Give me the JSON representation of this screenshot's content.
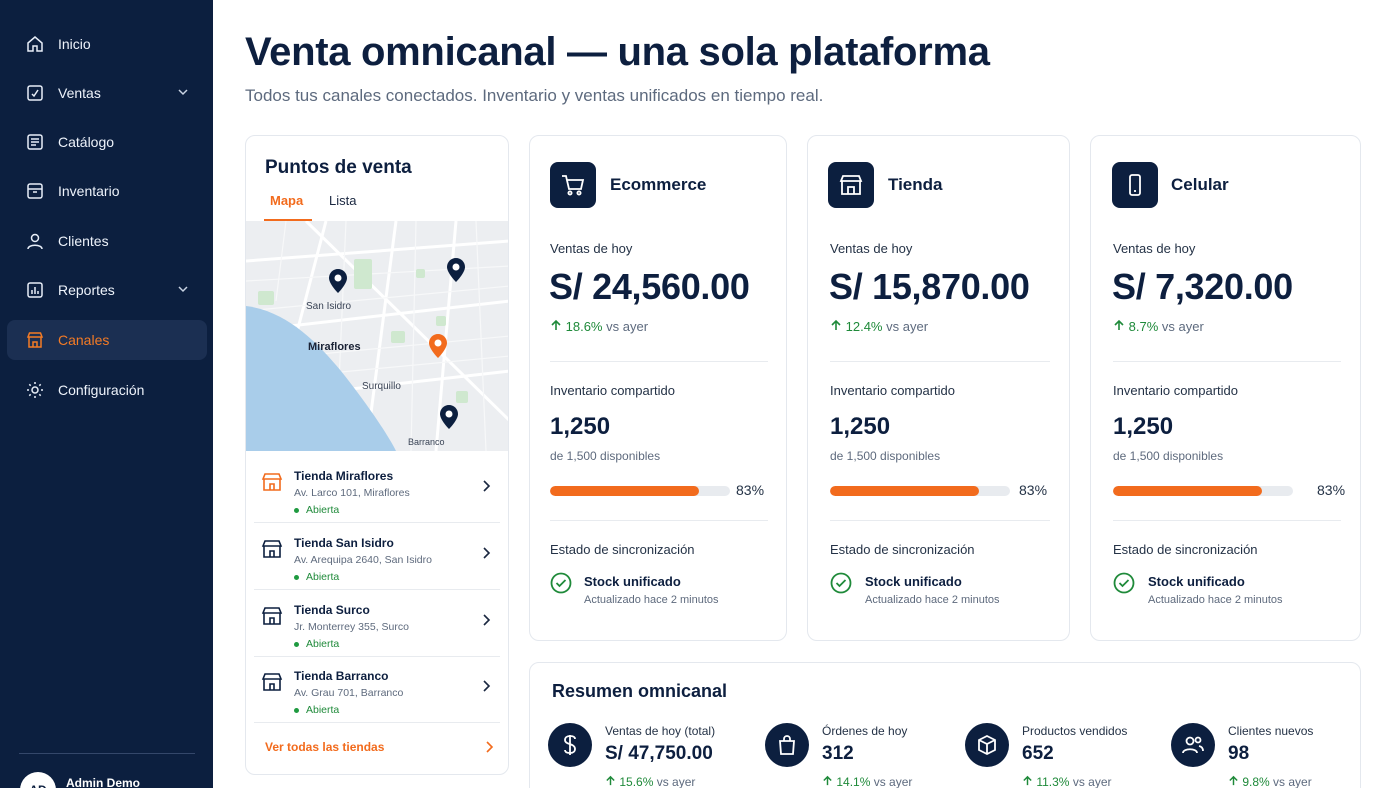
{
  "sidebar": {
    "items": [
      {
        "label": "Inicio",
        "icon": "home-icon"
      },
      {
        "label": "Ventas",
        "icon": "receipt-icon"
      },
      {
        "label": "Catálogo",
        "icon": "catalog-icon"
      },
      {
        "label": "Inventario",
        "icon": "inventory-icon"
      },
      {
        "label": "Clientes",
        "icon": "user-icon"
      },
      {
        "label": "Reportes",
        "icon": "chart-icon"
      },
      {
        "label": "Canales",
        "icon": "store-icon"
      },
      {
        "label": "Configuración",
        "icon": "gear-icon"
      }
    ],
    "active": "Canales",
    "user": {
      "initials": "AD",
      "name": "Admin Demo"
    }
  },
  "header": {
    "title": "Venta omnicanal — una sola plataforma",
    "subtitle": "Todos tus canales conectados. Inventario y ventas unificados en tiempo real."
  },
  "points_of_sale": {
    "title": "Puntos de venta",
    "tabs": [
      "Mapa",
      "Lista"
    ],
    "active_tab": "Mapa",
    "map_labels": [
      "San Isidro",
      "Miraflores",
      "Surquillo",
      "Barranco"
    ],
    "stores": [
      {
        "name": "Tienda Miraflores",
        "address": "Av. Larco 101, Miraflores",
        "status": "Abierta"
      },
      {
        "name": "Tienda San Isidro",
        "address": "Av. Arequipa 2640, San Isidro",
        "status": "Abierta"
      },
      {
        "name": "Tienda Surco",
        "address": "Jr. Monterrey 355, Surco",
        "status": "Abierta"
      },
      {
        "name": "Tienda Barranco",
        "address": "Av. Grau 701, Barranco",
        "status": "Abierta"
      }
    ],
    "view_all": "Ver todas las tiendas"
  },
  "channels": [
    {
      "name": "Ecommerce",
      "icon": "cart-icon",
      "sales_label": "Ventas de hoy",
      "sales": "S/ 24,560.00",
      "trend_pct": "18.6%",
      "trend_text": "vs ayer",
      "inv_label": "Inventario compartido",
      "inv_value": "1,250",
      "inv_avail": "de 1,500 disponibles",
      "inv_pct": "83%",
      "inv_fraction": 0.83,
      "sync_label": "Estado de sincronización",
      "sync_title": "Stock unificado",
      "sync_sub": "Actualizado hace 2 minutos"
    },
    {
      "name": "Tienda",
      "icon": "store-icon",
      "sales_label": "Ventas de hoy",
      "sales": "S/ 15,870.00",
      "trend_pct": "12.4%",
      "trend_text": "vs ayer",
      "inv_label": "Inventario compartido",
      "inv_value": "1,250",
      "inv_avail": "de 1,500 disponibles",
      "inv_pct": "83%",
      "inv_fraction": 0.83,
      "sync_label": "Estado de sincronización",
      "sync_title": "Stock unificado",
      "sync_sub": "Actualizado hace 2 minutos"
    },
    {
      "name": "Celular",
      "icon": "phone-icon",
      "sales_label": "Ventas de hoy",
      "sales": "S/ 7,320.00",
      "trend_pct": "8.7%",
      "trend_text": "vs ayer",
      "inv_label": "Inventario compartido",
      "inv_value": "1,250",
      "inv_avail": "de 1,500 disponibles",
      "inv_pct": "83%",
      "inv_fraction": 0.83,
      "sync_label": "Estado de sincronización",
      "sync_title": "Stock unificado",
      "sync_sub": "Actualizado hace 2 minutos"
    }
  ],
  "summary": {
    "title": "Resumen omnicanal",
    "kpis": [
      {
        "label": "Ventas de hoy (total)",
        "value": "S/ 47,750.00",
        "trend_pct": "15.6%",
        "trend_text": "vs ayer",
        "icon": "dollar-icon"
      },
      {
        "label": "Órdenes de hoy",
        "value": "312",
        "trend_pct": "14.1%",
        "trend_text": "vs ayer",
        "icon": "bag-icon"
      },
      {
        "label": "Productos vendidos",
        "value": "652",
        "trend_pct": "11.3%",
        "trend_text": "vs ayer",
        "icon": "box-icon"
      },
      {
        "label": "Clientes nuevos",
        "value": "98",
        "trend_pct": "9.8%",
        "trend_text": "vs ayer",
        "icon": "users-icon"
      }
    ]
  },
  "colors": {
    "navy": "#0c1f3f",
    "accent": "#f26b1d",
    "positive": "#1f8a3a"
  }
}
